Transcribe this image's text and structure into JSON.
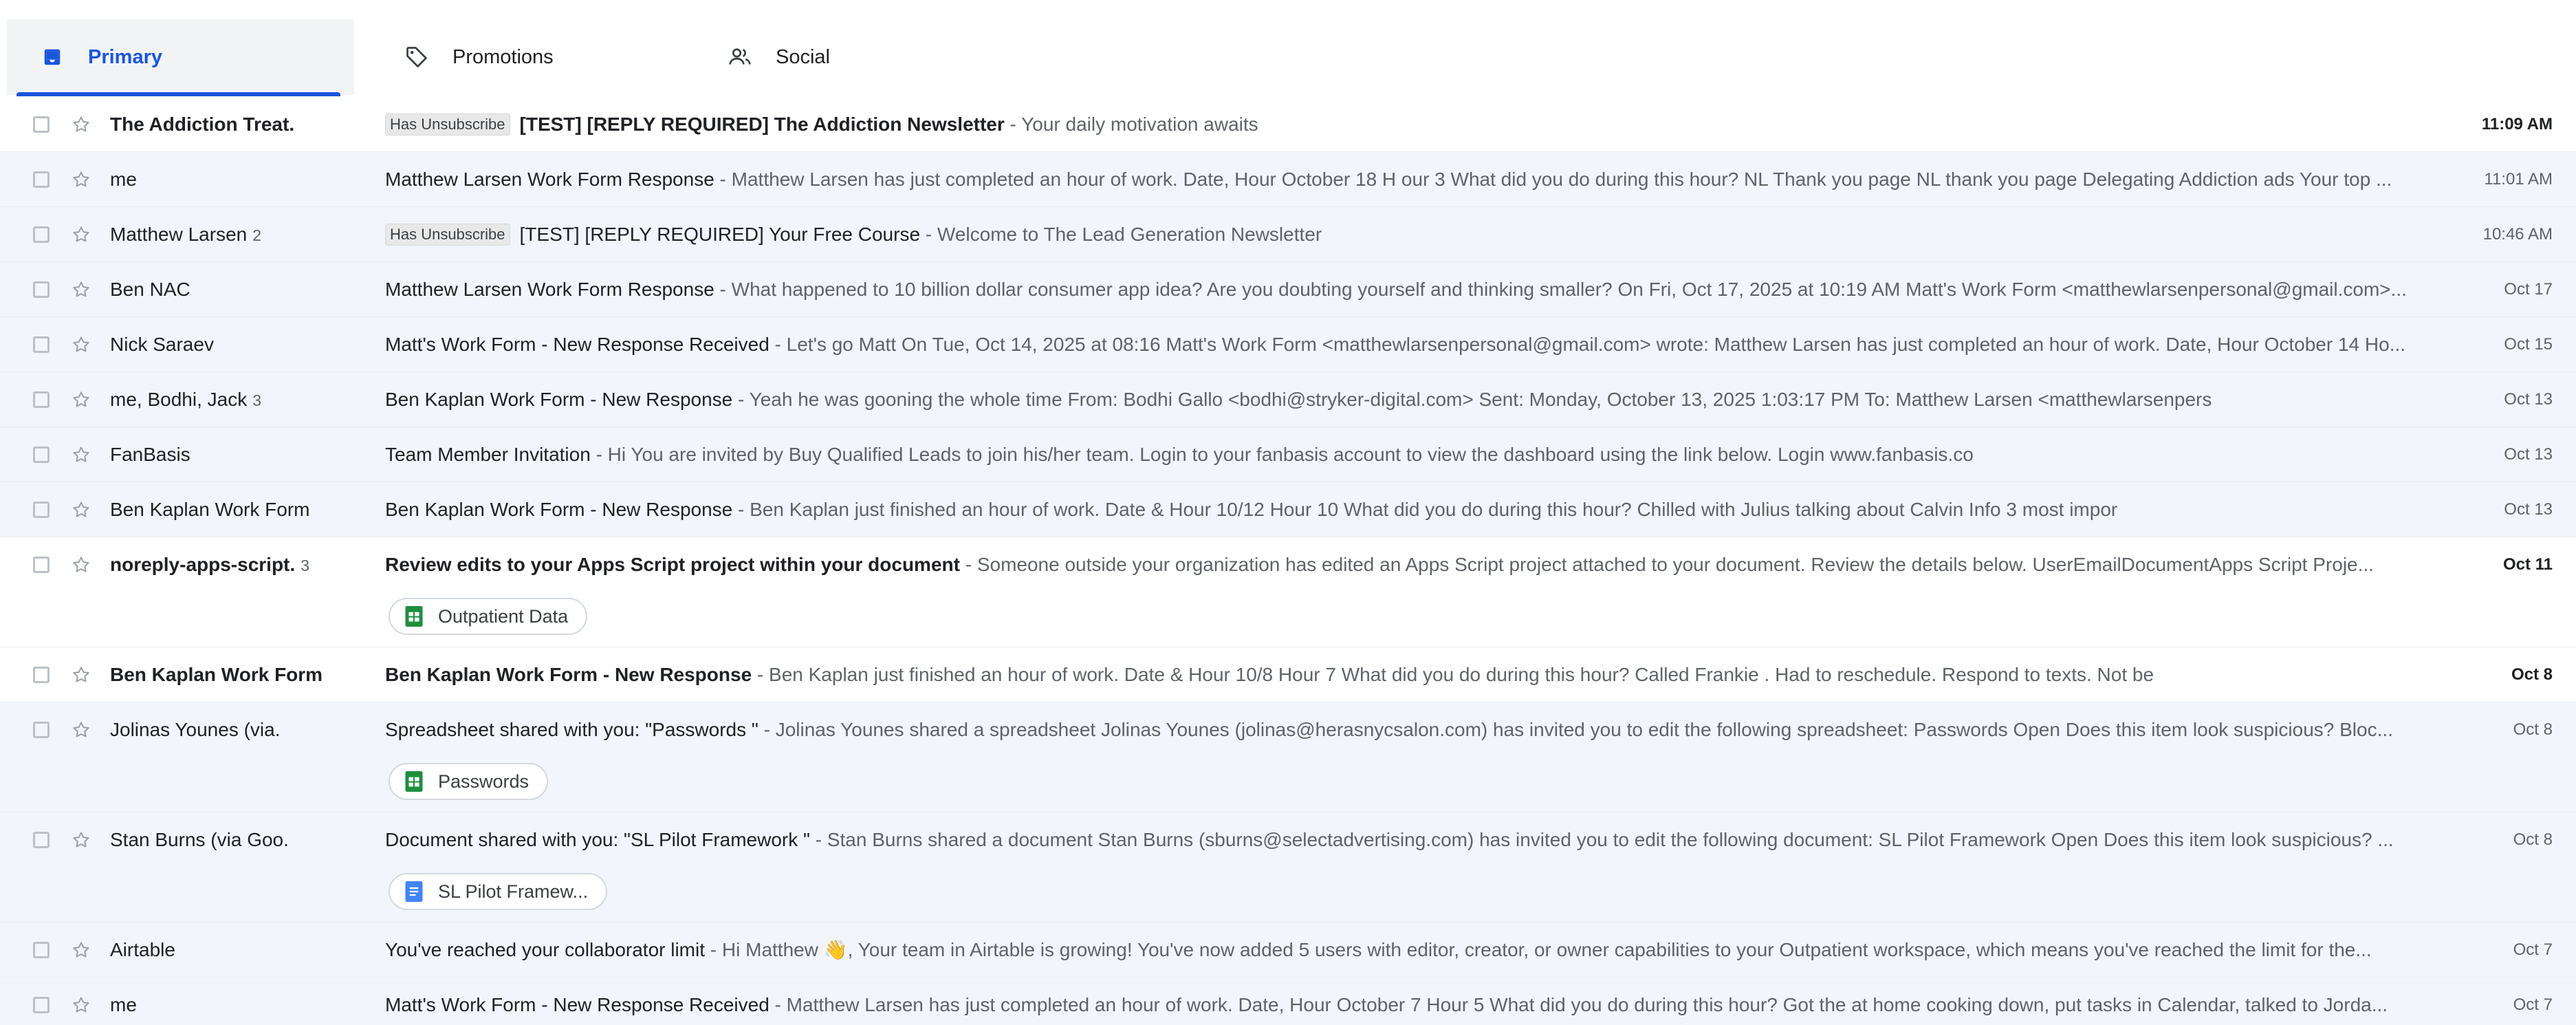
{
  "tabs": [
    {
      "label": "Primary",
      "icon": "inbox-icon",
      "active": true
    },
    {
      "label": "Promotions",
      "icon": "tag-icon"
    },
    {
      "label": "Social",
      "icon": "people-icon"
    }
  ],
  "colors": {
    "accent": "#1a56db",
    "read_bg": "#f2f6fc",
    "unread_bg": "#ffffff",
    "sheets_green": "#1e8e3e",
    "docs_blue": "#4285f4"
  },
  "emails": [
    {
      "sender": "The Addiction Treat.",
      "count": "",
      "badge": "Has Unsubscribe",
      "subject": "[TEST] [REPLY REQUIRED] The Addiction Newsletter",
      "snippet": " - Your daily motivation awaits",
      "date": "11:09 AM",
      "unread": true
    },
    {
      "sender": "me",
      "count": "",
      "badge": "",
      "subject": "Matthew Larsen Work Form Response",
      "snippet": " - Matthew Larsen has just completed an hour of work. Date, Hour October 18 H our 3 What did you do during this hour? NL Thank you page NL thank you page Delegating Addiction ads Your top ...",
      "date": "11:01 AM",
      "unread": false
    },
    {
      "sender": "Matthew Larsen",
      "count": "2",
      "badge": "Has Unsubscribe",
      "subject": "[TEST] [REPLY REQUIRED] Your Free Course",
      "snippet": " - Welcome to The Lead Generation Newsletter",
      "date": "10:46 AM",
      "unread": false
    },
    {
      "sender": "Ben NAC",
      "count": "",
      "badge": "",
      "subject": "Matthew Larsen Work Form Response",
      "snippet": " - What happened to 10 billion dollar consumer app idea? Are you doubting yourself and thinking smaller? On Fri, Oct 17, 2025 at 10:19 AM Matt's Work Form <matthewlarsenpersonal@gmail.com>...",
      "date": "Oct 17",
      "unread": false
    },
    {
      "sender": "Nick Saraev",
      "count": "",
      "badge": "",
      "subject": "Matt's Work Form - New Response Received",
      "snippet": " - Let's go Matt On Tue, Oct 14, 2025 at 08:16 Matt's Work Form <matthewlarsenpersonal@gmail.com> wrote: Matthew Larsen has just completed an hour of work. Date, Hour October 14 Ho...",
      "date": "Oct 15",
      "unread": false
    },
    {
      "sender": "me, Bodhi, Jack",
      "count": "3",
      "badge": "",
      "subject": "Ben Kaplan Work Form - New Response",
      "snippet": " - Yeah he was gooning the whole time From: Bodhi Gallo <bodhi@stryker-digital.com> Sent: Monday, October 13, 2025 1:03:17 PM To: Matthew Larsen <matthewlarsenpers",
      "date": "Oct 13",
      "unread": false
    },
    {
      "sender": "FanBasis",
      "count": "",
      "badge": "",
      "subject": "Team Member Invitation",
      "snippet": " - Hi You are invited by Buy Qualified Leads to join his/her team. Login to your fanbasis account to view the dashboard using the link below. Login www.fanbasis.co",
      "date": "Oct 13",
      "unread": false
    },
    {
      "sender": "Ben Kaplan Work Form",
      "count": "",
      "badge": "",
      "subject": "Ben Kaplan Work Form - New Response",
      "snippet": " - Ben Kaplan just finished an hour of work. Date & Hour 10/12 Hour 10 What did you do during this hour? Chilled with Julius talking about Calvin Info 3 most impor",
      "date": "Oct 13",
      "unread": false
    },
    {
      "sender": "noreply-apps-script.",
      "count": "3",
      "badge": "",
      "subject": "Review edits to your Apps Script project within your document",
      "snippet": " - Someone outside your organization has edited an Apps Script project attached to your document. Review the details below. UserEmailDocumentApps Script Proje...",
      "date": "Oct 11",
      "unread": true,
      "chip": {
        "label": "Outpatient Data",
        "icon": "sheets-icon"
      }
    },
    {
      "sender": "Ben Kaplan Work Form",
      "count": "",
      "badge": "",
      "subject": "Ben Kaplan Work Form - New Response",
      "snippet": " - Ben Kaplan just finished an hour of work. Date & Hour 10/8 Hour 7 What did you do during this hour? Called Frankie . Had to reschedule. Respond to texts. Not be",
      "date": "Oct 8",
      "unread": true
    },
    {
      "sender": "Jolinas Younes (via.",
      "count": "",
      "badge": "",
      "subject": "Spreadsheet shared with you: \"Passwords \"",
      "snippet": " - Jolinas Younes shared a spreadsheet Jolinas Younes (jolinas@herasnycsalon.com) has invited you to edit the following spreadsheet: Passwords Open Does this item look suspicious? Bloc...",
      "date": "Oct 8",
      "unread": false,
      "chip": {
        "label": "Passwords",
        "icon": "sheets-icon"
      }
    },
    {
      "sender": "Stan Burns (via Goo.",
      "count": "",
      "badge": "",
      "subject": "Document shared with you: \"SL Pilot Framework \"",
      "snippet": " - Stan Burns shared a document Stan Burns (sburns@selectadvertising.com) has invited you to edit the following document: SL Pilot Framework Open Does this item look suspicious? ...",
      "date": "Oct 8",
      "unread": false,
      "chip": {
        "label": "SL Pilot Framew...",
        "icon": "docs-icon"
      }
    },
    {
      "sender": "Airtable",
      "count": "",
      "badge": "",
      "subject": "You've reached your collaborator limit",
      "snippet": " - Hi Matthew 👋, Your team in Airtable is growing! You've now added 5 users with editor, creator, or owner capabilities to your Outpatient workspace, which means you've reached the limit for the...",
      "date": "Oct 7",
      "unread": false
    },
    {
      "sender": "me",
      "count": "",
      "badge": "",
      "subject": "Matt's Work Form - New Response Received",
      "snippet": " - Matthew Larsen has just completed an hour of work. Date, Hour October 7 Hour 5 What did you do during this hour? Got the at home cooking down, put tasks in Calendar, talked to Jorda...",
      "date": "Oct 7",
      "unread": false
    }
  ]
}
